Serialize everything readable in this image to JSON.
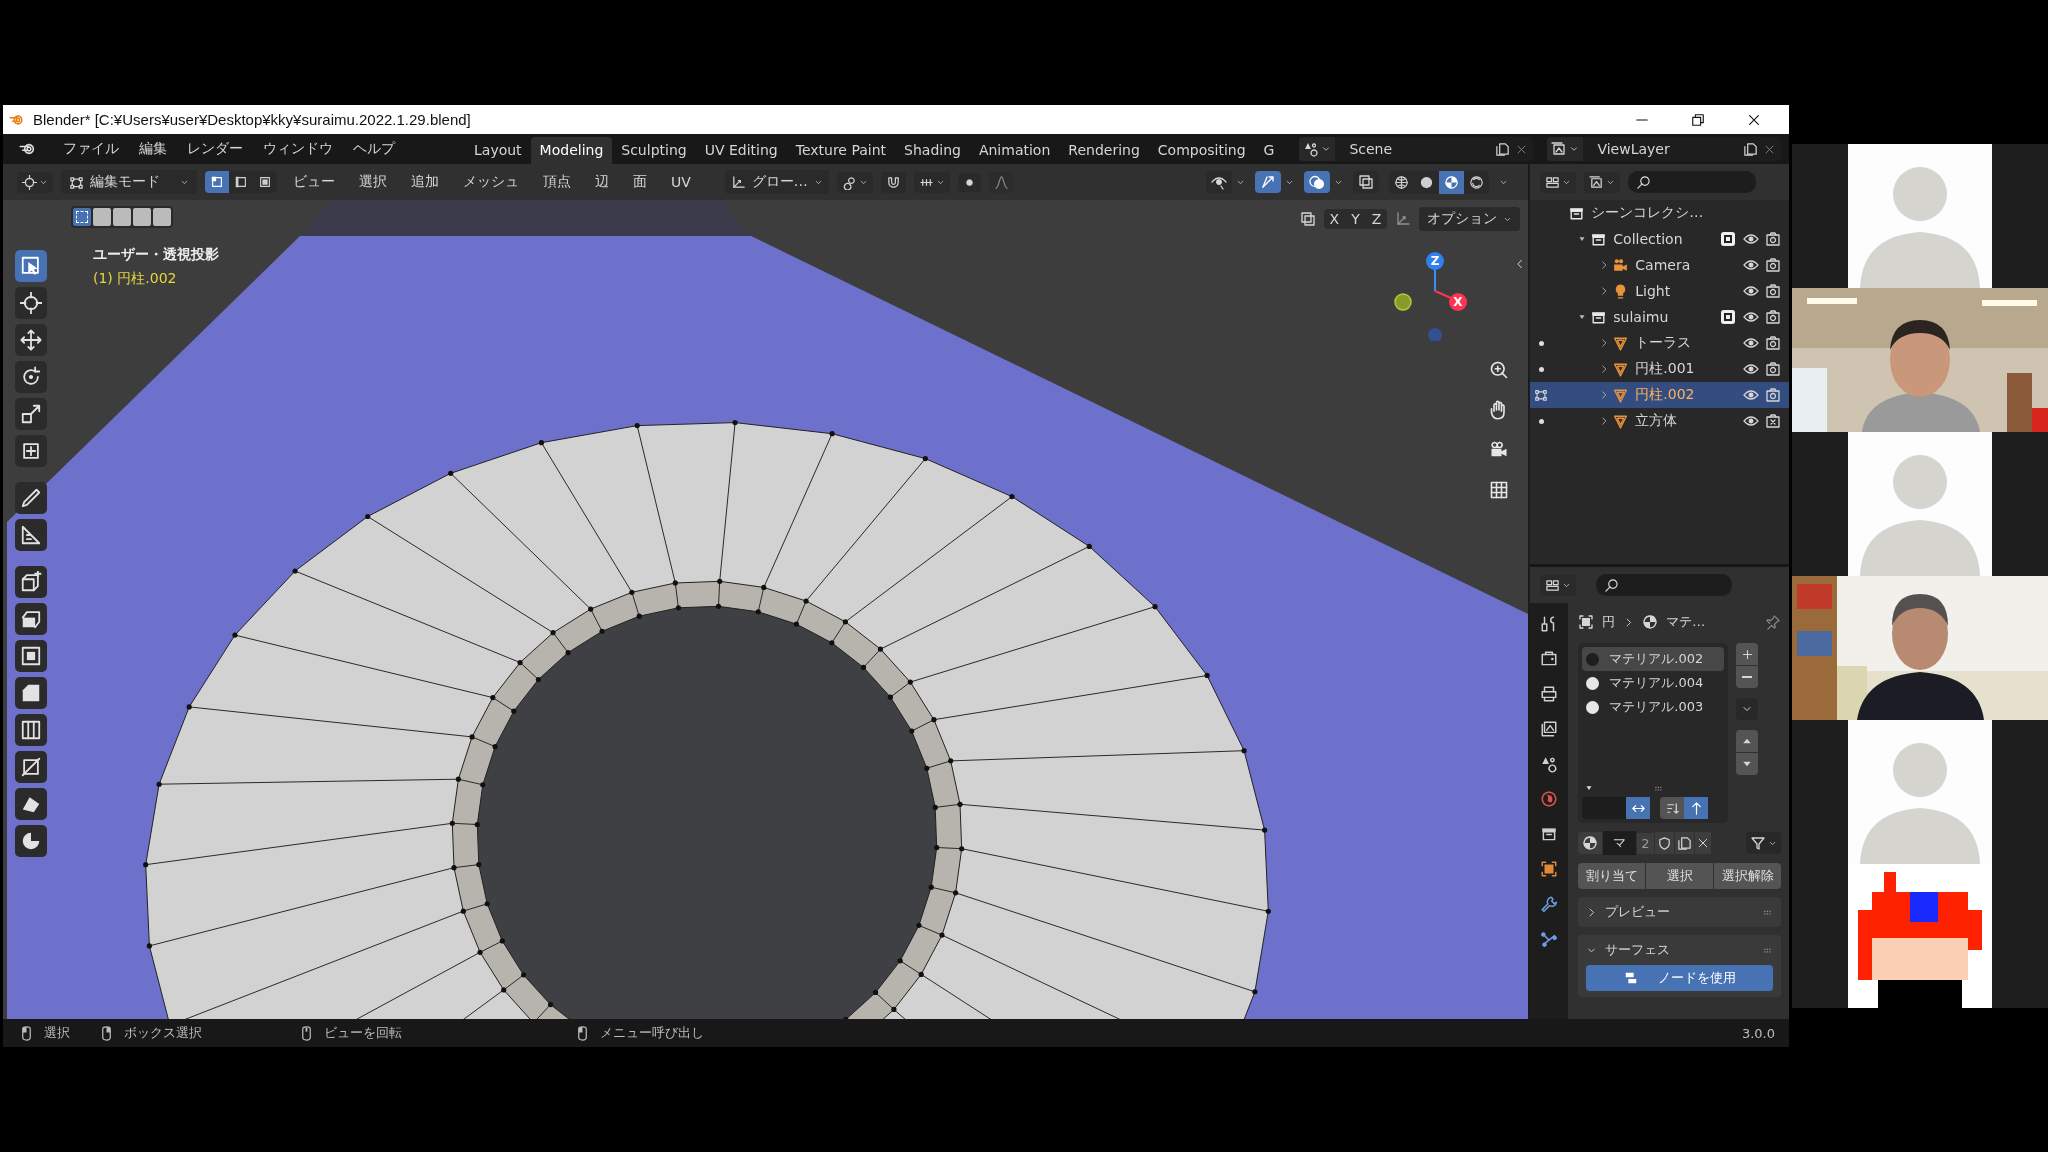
{
  "title_bar": {
    "title": "Blender* [C:¥Users¥user¥Desktop¥kky¥suraimu.2022.1.29.blend]"
  },
  "menu_bar": {
    "menus": [
      "ファイル",
      "編集",
      "レンダー",
      "ウィンドウ",
      "ヘルプ"
    ],
    "workspaces": [
      {
        "label": "Layout",
        "selected": false
      },
      {
        "label": "Modeling",
        "selected": true
      },
      {
        "label": "Sculpting",
        "selected": false
      },
      {
        "label": "UV Editing",
        "selected": false
      },
      {
        "label": "Texture Paint",
        "selected": false
      },
      {
        "label": "Shading",
        "selected": false
      },
      {
        "label": "Animation",
        "selected": false
      },
      {
        "label": "Rendering",
        "selected": false
      },
      {
        "label": "Compositing",
        "selected": false
      },
      {
        "label": "G",
        "selected": false
      }
    ],
    "scene": "Scene",
    "view_layer": "ViewLayer"
  },
  "header": {
    "mode": "編集モード",
    "select_modes": [
      {
        "kind": "vertex",
        "selected": true
      },
      {
        "kind": "edge",
        "selected": false
      },
      {
        "kind": "face",
        "selected": false
      }
    ],
    "menus": [
      "ビュー",
      "選択",
      "追加",
      "メッシュ",
      "頂点",
      "辺",
      "面",
      "UV"
    ],
    "orientation": "グロー…",
    "toggles": [
      {
        "kind": "visibility",
        "on": false
      },
      {
        "kind": "gizmo",
        "on": true
      },
      {
        "kind": "overlay",
        "on": true
      },
      {
        "kind": "xray",
        "on": false
      }
    ],
    "shading": [
      {
        "kind": "wireframe",
        "selected": false
      },
      {
        "kind": "solid",
        "selected": false
      },
      {
        "kind": "material",
        "selected": true
      },
      {
        "kind": "rendered",
        "selected": false
      }
    ]
  },
  "viewport": {
    "view_name": "ユーザー・透視投影",
    "object_label": "(1) 円柱.002",
    "axes": [
      "X",
      "Y",
      "Z"
    ],
    "options": "オプション",
    "gizmo_labels": [
      "Z",
      "X"
    ],
    "box_modes": [
      {
        "selected": true
      },
      {
        "selected": false
      },
      {
        "selected": false
      },
      {
        "selected": false
      },
      {
        "selected": false
      }
    ],
    "tools": [
      {
        "kind": "select",
        "selected": true
      },
      {
        "kind": "cursor",
        "selected": false
      },
      {
        "kind": "move",
        "selected": false
      },
      {
        "kind": "rotate",
        "selected": false
      },
      {
        "kind": "scale",
        "selected": false
      },
      {
        "kind": "transform",
        "selected": false
      },
      {
        "kind": "annotate",
        "selected": false
      },
      {
        "kind": "measure",
        "selected": false
      },
      {
        "kind": "addcube",
        "selected": false
      },
      {
        "kind": "extrude",
        "selected": false
      },
      {
        "kind": "inset",
        "selected": false
      },
      {
        "kind": "bevel",
        "selected": false
      },
      {
        "kind": "loopcut",
        "selected": false
      },
      {
        "kind": "knife",
        "selected": false
      },
      {
        "kind": "polybuild",
        "selected": false
      },
      {
        "kind": "spin",
        "selected": false
      }
    ]
  },
  "outliner": {
    "rows": [
      {
        "label": "シーンコレクシ…",
        "kind": "scene",
        "children": [
          {
            "label": "Collection",
            "kind": "collection",
            "expanded": true,
            "checked": true,
            "selected": false,
            "renderable": true,
            "children": [
              {
                "label": "Camera",
                "kind": "camera",
                "expanded": false,
                "selected": false,
                "renderable": true
              },
              {
                "label": "Light",
                "kind": "light",
                "expanded": false,
                "selected": false,
                "renderable": true
              }
            ]
          },
          {
            "label": "sulaimu",
            "kind": "collection",
            "expanded": true,
            "checked": true,
            "selected": false,
            "renderable": true,
            "children": [
              {
                "label": "トーラス",
                "kind": "mesh",
                "expanded": false,
                "selected": false,
                "renderable": true
              },
              {
                "label": "円柱.001",
                "kind": "mesh",
                "expanded": false,
                "selected": false,
                "renderable": true
              },
              {
                "label": "円柱.002",
                "kind": "mesh",
                "expanded": false,
                "selected": true,
                "renderable": true
              },
              {
                "label": "立方体",
                "kind": "mesh",
                "expanded": false,
                "selected": false,
                "renderable": false
              }
            ]
          }
        ]
      }
    ]
  },
  "properties": {
    "breadcrumb": [
      "円",
      "マテ…"
    ],
    "materials": [
      {
        "name": "マテリアル.002",
        "color": "#1e1e1e",
        "selected": true
      },
      {
        "name": "マテリアル.004",
        "color": "#e6e6e6",
        "selected": false
      },
      {
        "name": "マテリアル.003",
        "color": "#e6e6e6",
        "selected": false
      }
    ],
    "slot_field": "マ",
    "users": "2",
    "buttons": [
      "割り当て",
      "選択",
      "選択解除"
    ],
    "panels": [
      {
        "title": "プレビュー",
        "expanded": false
      },
      {
        "title": "サーフェス",
        "expanded": true
      }
    ],
    "node_button": "ノードを使用"
  },
  "status_bar": {
    "hints": [
      "選択",
      "ボックス選択",
      "ビューを回転",
      "メニュー呼び出し"
    ],
    "version": "3.0.0"
  },
  "call": {
    "participants": [
      {
        "kind": "placeholder"
      },
      {
        "kind": "video"
      },
      {
        "kind": "placeholder"
      },
      {
        "kind": "video"
      },
      {
        "kind": "placeholder"
      },
      {
        "kind": "avatar"
      }
    ]
  }
}
